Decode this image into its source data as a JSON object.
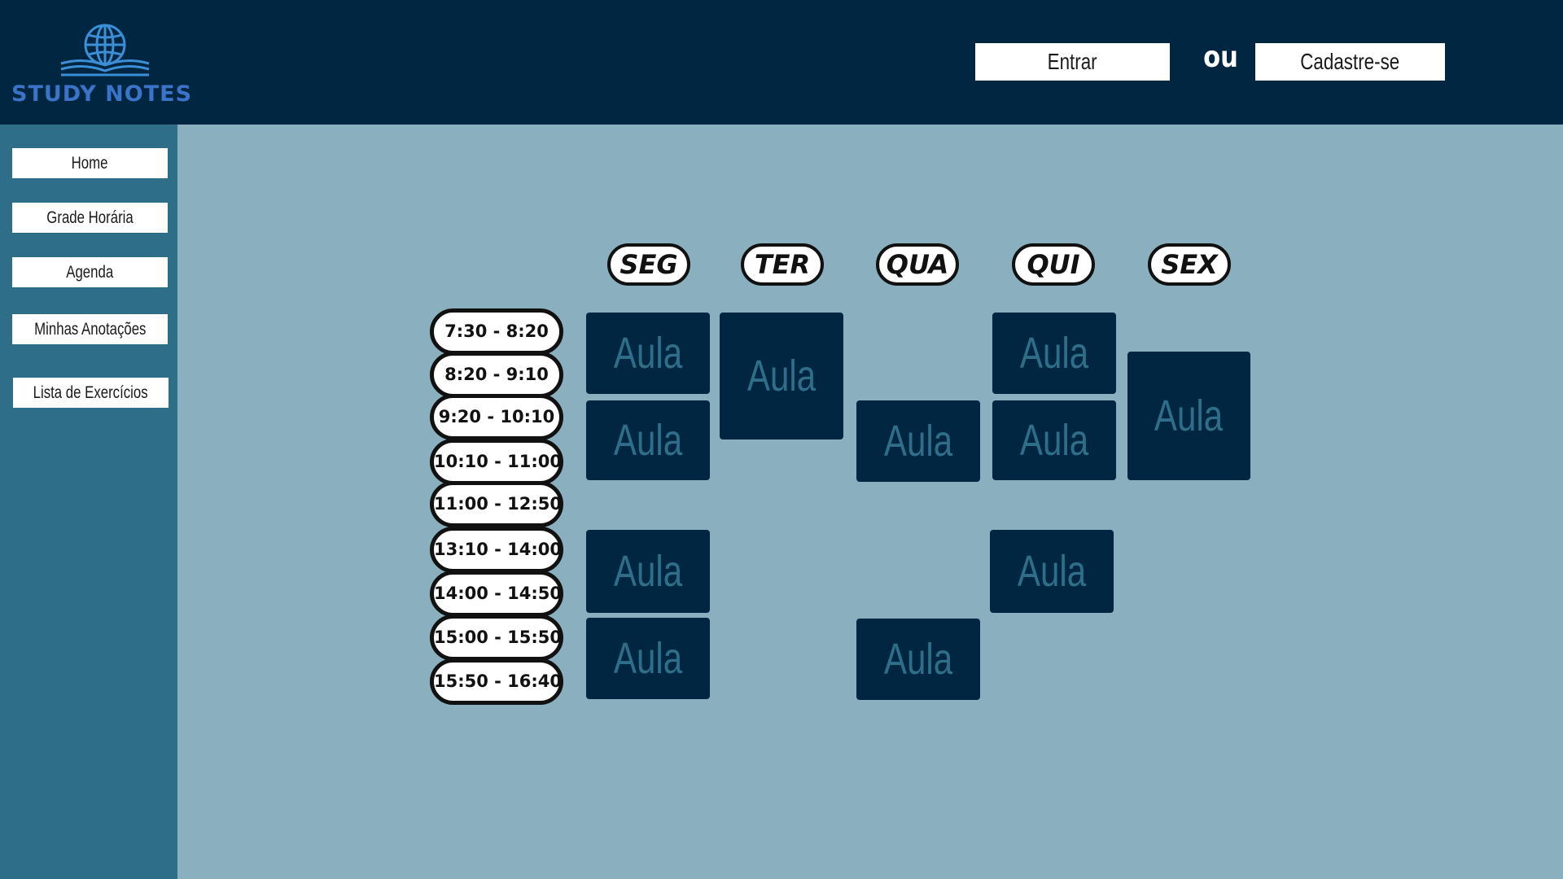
{
  "header": {
    "logo_text": "STUDY NOTES",
    "login_label": "Entrar",
    "or_text": "ou",
    "signup_label": "Cadastre-se"
  },
  "sidebar": {
    "items": [
      {
        "label": "Home"
      },
      {
        "label": "Grade Horária"
      },
      {
        "label": "Agenda"
      },
      {
        "label": "Minhas Anotações"
      },
      {
        "label": "Lista de Exercícios"
      }
    ]
  },
  "schedule": {
    "days": [
      "SEG",
      "TER",
      "QUA",
      "QUI",
      "SEX"
    ],
    "times": [
      "7:30 - 8:20",
      "8:20 - 9:10",
      "9:20 - 10:10",
      "10:10 - 11:00",
      "11:00 - 12:50",
      "13:10 - 14:00",
      "14:00 - 14:50",
      "15:00 - 15:50",
      "15:50 - 16:40"
    ],
    "class_label": "Aula"
  },
  "colors": {
    "header_bg": "#002641",
    "sidebar_bg": "#2e6e88",
    "content_bg": "#8aafbe",
    "block_bg": "#002641",
    "block_text": "#2e6e88",
    "logo": "#3a74c8"
  }
}
